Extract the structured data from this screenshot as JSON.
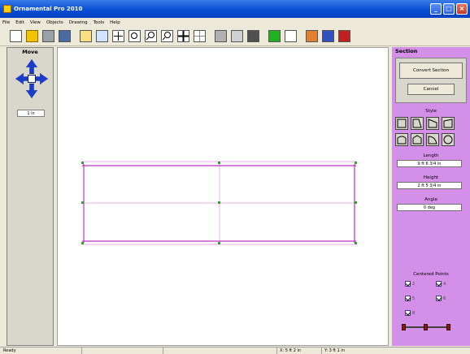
{
  "window": {
    "title": "Ornamental Pro 2010"
  },
  "menu": [
    "File",
    "Edit",
    "View",
    "Objects",
    "Drawing",
    "Tools",
    "Help"
  ],
  "toolbar": {
    "icons": [
      "new-file-icon",
      "open-folder-icon",
      "print-icon",
      "save-icon",
      "measure-icon",
      "add-line-icon",
      "crosshair-icon",
      "zoom-window-icon",
      "zoom-in-icon",
      "zoom-out-icon",
      "pan-icon",
      "grid-icon",
      "shape-circle-icon",
      "shape-circle-outline-icon",
      "shape-filled-icon",
      "green-square-icon",
      "white-square-icon",
      "picture-icon",
      "settings-icon",
      "figure-icon"
    ]
  },
  "left_panel": {
    "title": "Move",
    "step_value": "1 in"
  },
  "right_panel": {
    "title": "Section",
    "convert_label": "Convert Section",
    "cancel_label": "Cancel",
    "style_label": "Style",
    "length_label": "Length",
    "length_value": "9 ft 6 3/4 in",
    "height_label": "Height",
    "height_value": "2 ft 5 3/4 in",
    "angle_label": "Angle",
    "angle_value": "0 deg",
    "points_label": "Centered Points",
    "points": [
      "2",
      "4",
      "5",
      "6",
      "8"
    ]
  },
  "status": {
    "ready": "Ready",
    "x": "X: 5 ft 2 in",
    "y": "Y: 3 ft 1 in"
  },
  "colors": {
    "title_blue": "#0a4fd6",
    "panel_purple": "#d490e8",
    "outline_magenta": "#c030c0",
    "guide_pink": "#e090e8",
    "handle_green": "#30a030"
  }
}
